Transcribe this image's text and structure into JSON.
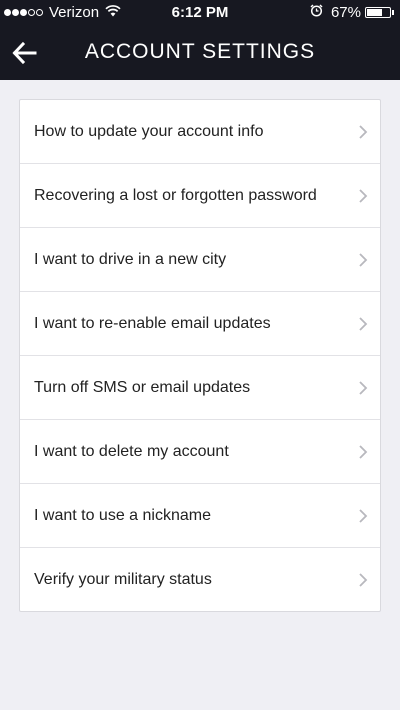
{
  "status_bar": {
    "carrier": "Verizon",
    "time": "6:12 PM",
    "battery_percent_label": "67%",
    "battery_level": 0.67,
    "signal_bars_filled": 3,
    "signal_bars_total": 5,
    "icons": [
      "signal-dots-icon",
      "wifi-icon",
      "alarm-clock-icon",
      "battery-icon"
    ]
  },
  "header": {
    "title": "ACCOUNT SETTINGS",
    "back_icon": "back-arrow-icon",
    "background_color": "#171821"
  },
  "items": [
    {
      "label": "How to update your account info"
    },
    {
      "label": "Recovering a lost or forgotten password"
    },
    {
      "label": "I want to drive in a new city"
    },
    {
      "label": "I want to re-enable email updates"
    },
    {
      "label": "Turn off SMS or email updates"
    },
    {
      "label": "I want to delete my account"
    },
    {
      "label": "I want to use a nickname"
    },
    {
      "label": "Verify your military status"
    }
  ],
  "item_icon": "chevron-right-icon"
}
